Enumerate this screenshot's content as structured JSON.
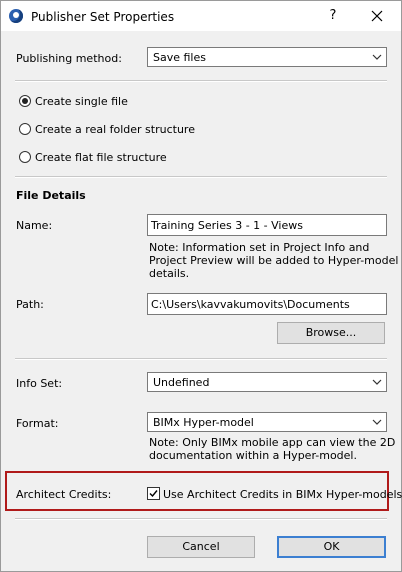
{
  "window": {
    "title": "Publisher Set Properties",
    "help_label": "?",
    "accent_color": "#3c7fd1",
    "highlight_color": "#b01a1a"
  },
  "publishing": {
    "label": "Publishing method:",
    "value": "Save files"
  },
  "options": [
    {
      "label": "Create single file",
      "selected": true
    },
    {
      "label": "Create a real folder structure",
      "selected": false
    },
    {
      "label": "Create flat file structure",
      "selected": false
    }
  ],
  "file_details": {
    "heading": "File Details",
    "name_label": "Name:",
    "name_value": "Training Series 3 - 1 - Views",
    "name_note": [
      "Note: Information set in Project Info and",
      "Project Preview will be added to Hyper-model",
      "details."
    ],
    "path_label": "Path:",
    "path_value": "C:\\Users\\kavvakumovits\\Documents",
    "browse_label": "Browse..."
  },
  "info_set": {
    "label": "Info Set:",
    "value": "Undefined"
  },
  "format": {
    "label": "Format:",
    "value": "BIMx Hyper-model",
    "note": [
      "Note: Only BIMx mobile app can view the 2D",
      "documentation within a Hyper-model."
    ]
  },
  "architect_credits": {
    "label": "Architect Credits:",
    "checkbox_label": "Use Architect Credits in BIMx Hyper-models.",
    "checked": true
  },
  "buttons": {
    "cancel": "Cancel",
    "ok": "OK"
  }
}
